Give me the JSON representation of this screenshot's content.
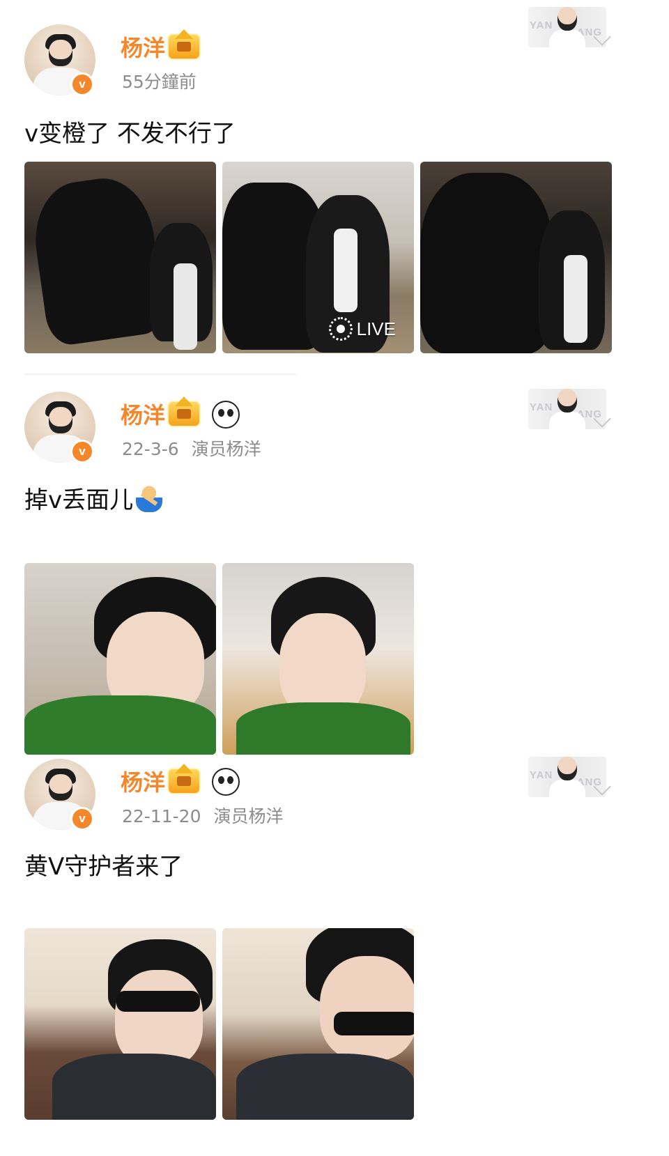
{
  "posts": [
    {
      "user_name": "杨洋",
      "time": "55分鐘前",
      "source": "",
      "content": "v变橙了 不发不行了",
      "badges": [
        "crown-icon"
      ],
      "images": [
        {
          "name": "horse-photo-1"
        },
        {
          "name": "horse-photo-2",
          "label": "LIVE"
        },
        {
          "name": "horse-photo-3"
        }
      ],
      "card_text": [
        "YAN",
        "ANG"
      ]
    },
    {
      "user_name": "杨洋",
      "time": "22-3-6",
      "source": "演员杨洋",
      "content": "掉v丢面儿",
      "badges": [
        "crown-icon",
        "panda-icon"
      ],
      "emoji": "person-gesturing-no-icon",
      "images": [
        {
          "name": "selfie-green-sweater-1"
        },
        {
          "name": "selfie-green-sweater-2"
        }
      ],
      "card_text": [
        "YAN",
        "ANG"
      ]
    },
    {
      "user_name": "杨洋",
      "time": "22-11-20",
      "source": "演员杨洋",
      "content": "黄V守护者来了",
      "badges": [
        "crown-icon",
        "panda-icon"
      ],
      "images": [
        {
          "name": "sunglasses-photo-1"
        },
        {
          "name": "sunglasses-photo-2"
        }
      ],
      "card_text": [
        "YAN",
        "ANG"
      ]
    }
  ],
  "colors": {
    "username": "#f6862a",
    "verified_badge": "#f6862a",
    "meta_text": "#8c8c8c"
  },
  "icons": {
    "verified": "v-badge-icon",
    "live": "live-photo-icon",
    "chevron": "chevron-down-icon"
  }
}
